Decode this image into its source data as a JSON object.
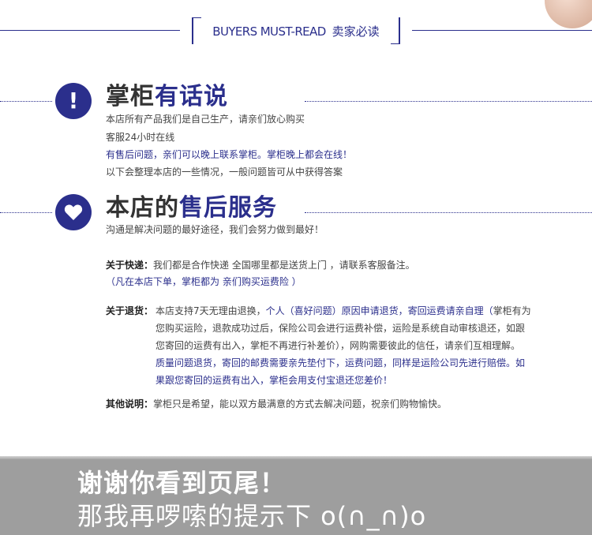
{
  "header": {
    "title_en": "BUYERS MUST-READ",
    "title_zh": "卖家必读"
  },
  "section1": {
    "title_dark": "掌柜",
    "title_blue": "有话说",
    "lines": [
      "本店所有产品我们是自己生产，请亲们放心购买",
      "客服24小时在线",
      "有售后问题，亲们可以晚上联系掌柜。掌柜晚上都会在线！",
      "以下会整理本店的一些情况，一般问题皆可从中获得答案"
    ]
  },
  "section2": {
    "title_dark": "本店的",
    "title_blue": "售后服务",
    "subtitle": "沟通是解决问题的最好途径，我们会努力做到最好！",
    "express_label": "关于快递：",
    "express_text": "我们都是合作快递 全国哪里都是送货上门 ，请联系客服备注。",
    "express_note": "（凡在本店下单，掌柜都为 亲们购买运费险 ）",
    "return_label": "关于退货：",
    "return_l1_a": "本店支持7天无理由退换，",
    "return_l1_b": "个人（喜好问题）原因申请退货，寄回运费请亲自理（",
    "return_l1_c": "掌柜有为",
    "return_l2": "您购买运险，退款成功过后，保险公司会进行运费补偿，运险是系统自动审核退还，如跟",
    "return_l3": "您寄回的运费有出入，掌柜不再进行补差价），网购需要彼此的信任，请亲们互相理解。",
    "return_l4": "质量问题退货，寄回的邮费需要亲先垫付下，运费问题，同样是运险公司先进行赔偿。如",
    "return_l5": "果跟您寄回的运费有出入，掌柜会用支付宝退还您差价！",
    "other_label": "其他说明：",
    "other_text": "掌柜只是希望，能以双方最满意的方式去解决问题，祝亲们购物愉快。"
  },
  "footer": {
    "line1": "谢谢你看到页尾！",
    "line2": "那我再啰嗦的提示下 o(∩_∩)o"
  },
  "colors": {
    "accent": "#2b2f8c",
    "footer_bg": "#9e9e9e"
  },
  "icons": {
    "section1": "exclamation-icon",
    "section2": "heart-icon"
  }
}
